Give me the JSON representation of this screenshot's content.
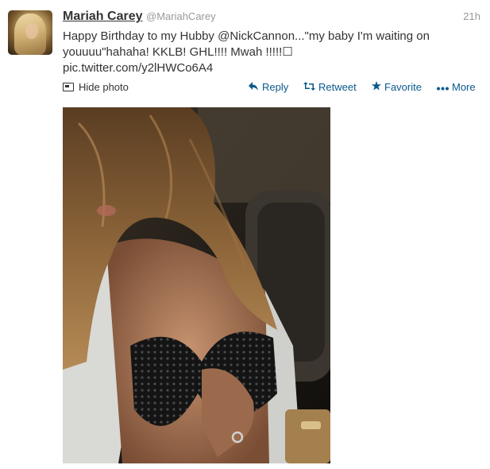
{
  "tweet": {
    "name": "Mariah Carey",
    "handle": "@MariahCarey",
    "time": "21h",
    "text_before": "Happy Birthday to my Hubby ",
    "mention": "@NickCannon",
    "text_after": "...\"my baby I'm waiting on youuuu\"hahaha! KKLB! GHL!!!! Mwah !!!!!☐",
    "link": "pic.twitter.com/y2lHWCo6A4"
  },
  "actions": {
    "hide_photo": "Hide photo",
    "reply": "Reply",
    "retweet": "Retweet",
    "favorite": "Favorite",
    "more": "More"
  },
  "icons": {
    "avatar": "profile-avatar",
    "hide_photo": "photo-icon",
    "reply": "reply-arrow-icon",
    "retweet": "retweet-icon",
    "favorite": "star-icon",
    "more": "ellipsis-icon"
  },
  "colors": {
    "action": "#0a5a8c",
    "meta": "#999999",
    "text": "#333333"
  }
}
